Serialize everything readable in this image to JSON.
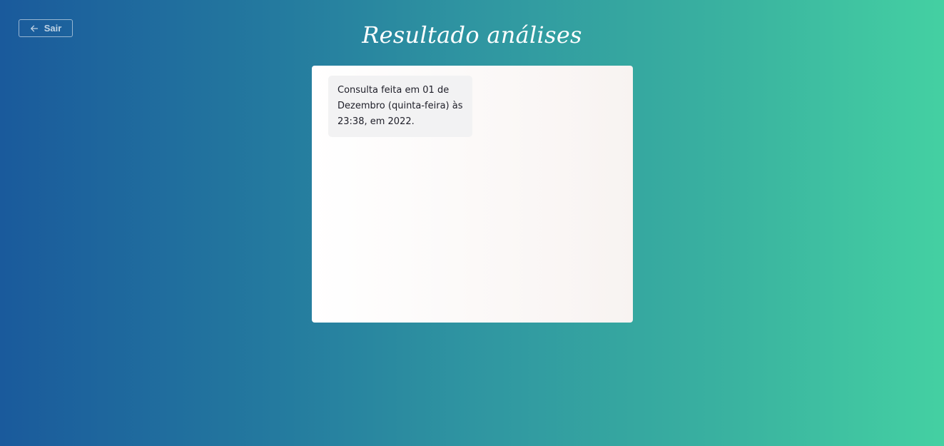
{
  "header": {
    "back_label": "Sair",
    "back_icon": "arrow-left-icon",
    "title": "Resultado análises"
  },
  "results": {
    "items": [
      {
        "text": "Consulta feita em 01 de Dezembro (quinta-feira) às 23:38, em 2022."
      }
    ]
  },
  "colors": {
    "gradient_start": "#1a5a9c",
    "gradient_end": "#44d0a2",
    "card_background": "#ffffff",
    "item_background": "#f2f2f3"
  }
}
